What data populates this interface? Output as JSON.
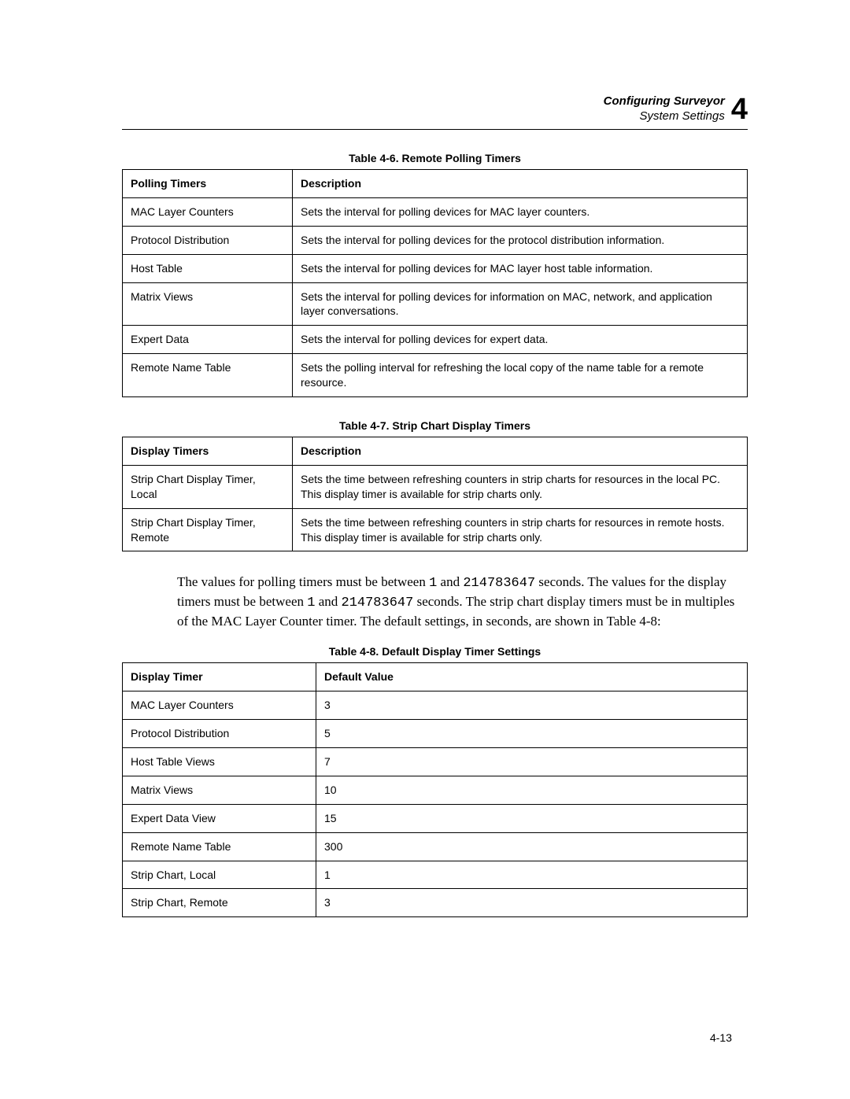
{
  "header": {
    "title": "Configuring Surveyor",
    "subtitle": "System Settings",
    "chapter": "4"
  },
  "table46": {
    "caption": "Table 4-6. Remote Polling Timers",
    "headers": [
      "Polling Timers",
      "Description"
    ],
    "rows": [
      [
        "MAC Layer Counters",
        "Sets the interval for polling devices for MAC layer counters."
      ],
      [
        "Protocol Distribution",
        "Sets the interval for polling devices for the protocol distribution information."
      ],
      [
        "Host Table",
        "Sets the interval for polling devices for MAC layer host table information."
      ],
      [
        "Matrix Views",
        "Sets the interval for polling devices for information on MAC, network, and application layer conversations."
      ],
      [
        "Expert Data",
        "Sets the interval for polling devices for expert data."
      ],
      [
        "Remote Name Table",
        "Sets the polling interval for refreshing the local copy of the name table for a remote resource."
      ]
    ]
  },
  "table47": {
    "caption": "Table 4-7. Strip Chart Display Timers",
    "headers": [
      "Display Timers",
      "Description"
    ],
    "rows": [
      [
        "Strip Chart Display Timer, Local",
        "Sets the time between refreshing counters in strip charts for resources in the local PC. This display timer is available for strip charts only."
      ],
      [
        "Strip Chart Display Timer, Remote",
        "Sets the time between refreshing counters in strip charts for resources in remote hosts. This display timer is available for strip charts only."
      ]
    ]
  },
  "paragraph": {
    "p1_a": "The values for polling timers must be between ",
    "p1_b": " and ",
    "p1_c": " seconds. The values for the display timers must be between ",
    "p1_d": " and ",
    "p1_e": " seconds. The strip chart display timers must be in multiples of the MAC Layer Counter timer. The default settings, in seconds, are shown in Table 4-8:",
    "n1": "1",
    "n2": "214783647",
    "n3": "1",
    "n4": "214783647"
  },
  "table48": {
    "caption": "Table 4-8. Default Display Timer Settings",
    "headers": [
      "Display Timer",
      "Default Value"
    ],
    "rows": [
      [
        "MAC Layer Counters",
        "3"
      ],
      [
        "Protocol Distribution",
        "5"
      ],
      [
        "Host Table Views",
        "7"
      ],
      [
        "Matrix Views",
        "10"
      ],
      [
        "Expert Data View",
        "15"
      ],
      [
        "Remote Name Table",
        "300"
      ],
      [
        "Strip Chart, Local",
        "1"
      ],
      [
        "Strip Chart, Remote",
        "3"
      ]
    ]
  },
  "pageNumber": "4-13"
}
